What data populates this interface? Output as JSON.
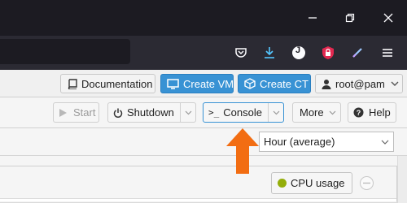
{
  "browser": {
    "window_controls": [
      {
        "name": "minimize",
        "icon": "minimize-icon"
      },
      {
        "name": "restore",
        "icon": "restore-icon"
      },
      {
        "name": "close",
        "icon": "close-icon"
      }
    ],
    "toolbar_icons": [
      "pocket-icon",
      "download-icon",
      "account-icon",
      "addon-lock-icon",
      "pen-icon",
      "menu-icon"
    ],
    "account_initial": "J",
    "colors": {
      "titlebar": "#1c1b22",
      "toolbar": "#2b2a33",
      "download_accent": "#54c6ff",
      "addon_red": "#e22850"
    }
  },
  "header": {
    "documentation": "Documentation",
    "create_vm": "Create VM",
    "create_ct": "Create CT",
    "user": "root@pam",
    "accent": "#3892d4"
  },
  "actions": {
    "start": "Start",
    "shutdown": "Shutdown",
    "console": "Console",
    "console_prefix": ">_",
    "more": "More",
    "help": "Help"
  },
  "timeframe": {
    "selected": "Hour (average)"
  },
  "graph": {
    "legend_item": "CPU usage",
    "legend_color": "#94ae0a"
  },
  "annotation": {
    "arrow_color": "#f26d12"
  }
}
